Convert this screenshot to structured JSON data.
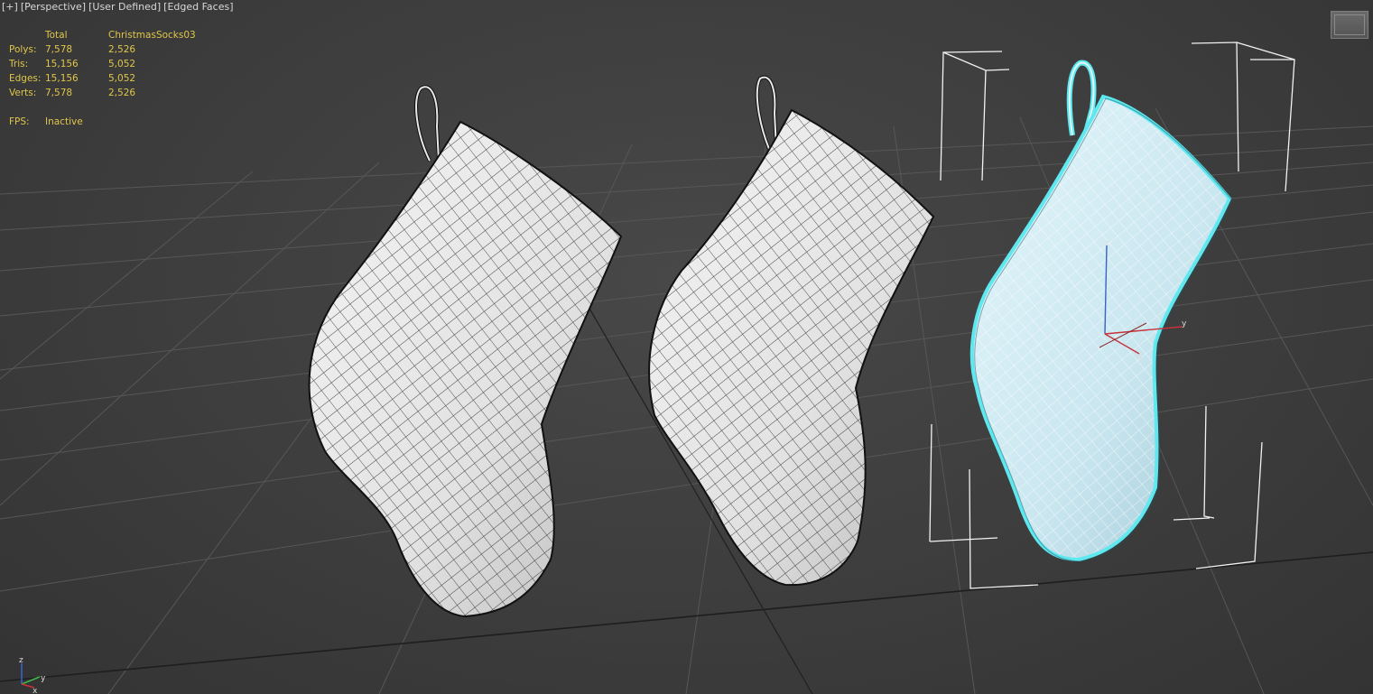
{
  "viewport": {
    "labels": [
      "[+]",
      "[Perspective]",
      "[User Defined]",
      "[Edged Faces]"
    ]
  },
  "stats": {
    "header": {
      "total": "Total",
      "object": "ChristmasSocks03"
    },
    "rows": [
      {
        "label": "Polys:",
        "total": "7,578",
        "object": "2,526"
      },
      {
        "label": "Tris:",
        "total": "15,156",
        "object": "5,052"
      },
      {
        "label": "Edges:",
        "total": "15,156",
        "object": "5,052"
      },
      {
        "label": "Verts:",
        "total": "7,578",
        "object": "2,526"
      }
    ],
    "fps": {
      "label": "FPS:",
      "value": "Inactive"
    }
  },
  "gizmo": {
    "x": "x",
    "y": "y",
    "z": "z"
  },
  "view_gizmo": {
    "x": "x",
    "y": "y",
    "z": "z"
  },
  "colors": {
    "background": "#3d3d3d",
    "grid": "#555555",
    "stats_text": "#e0c64a",
    "selection": "#5ee8f0",
    "sock_fill": "#e6e6e6",
    "selected_sock_fill": "#cdeaf2"
  },
  "icons": [
    "maximize-viewport-icon",
    "axis-tripod-icon"
  ]
}
